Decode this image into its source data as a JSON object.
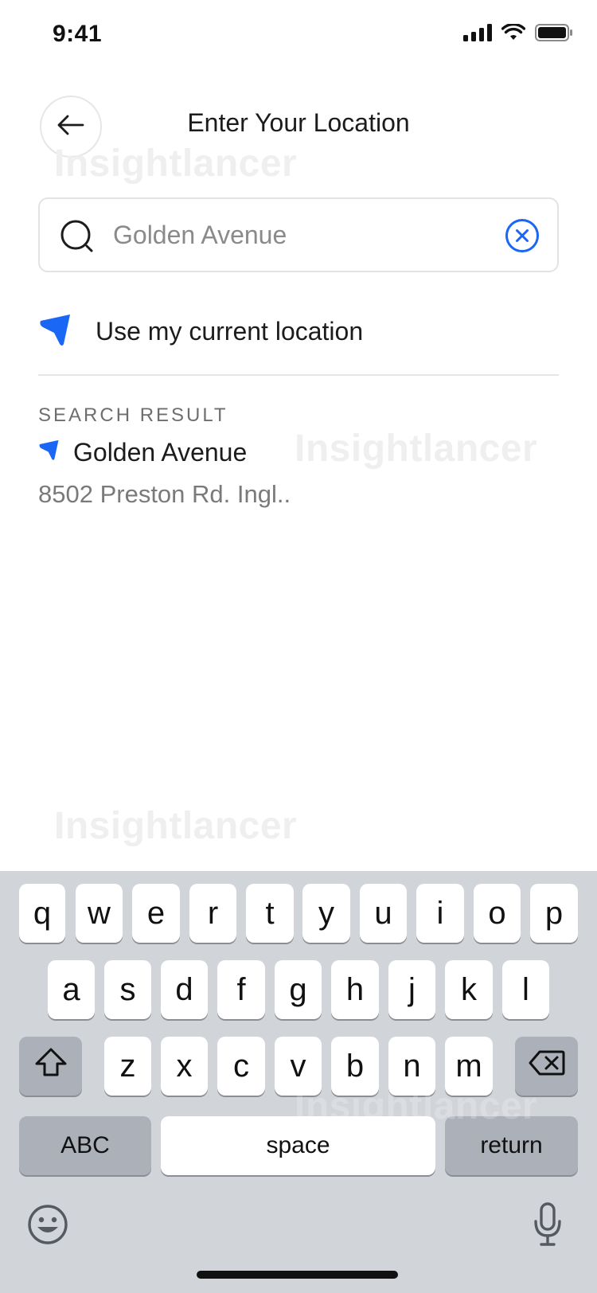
{
  "status_bar": {
    "time": "9:41"
  },
  "header": {
    "title": "Enter Your Location"
  },
  "search": {
    "value": "Golden Avenue"
  },
  "current_location": {
    "label": "Use my current location"
  },
  "results": {
    "section_label": "SEARCH RESULT",
    "items": [
      {
        "title": "Golden Avenue",
        "subtitle": "8502 Preston Rd. Ingl.."
      }
    ]
  },
  "watermark": "Insightlancer",
  "keyboard": {
    "row1": [
      "q",
      "w",
      "e",
      "r",
      "t",
      "y",
      "u",
      "i",
      "o",
      "p"
    ],
    "row2": [
      "a",
      "s",
      "d",
      "f",
      "g",
      "h",
      "j",
      "k",
      "l"
    ],
    "row3": [
      "z",
      "x",
      "c",
      "v",
      "b",
      "n",
      "m"
    ],
    "abc_label": "ABC",
    "space_label": "space",
    "return_label": "return"
  },
  "colors": {
    "accent": "#1a66f5",
    "keyboard_bg": "#d1d4d9"
  }
}
